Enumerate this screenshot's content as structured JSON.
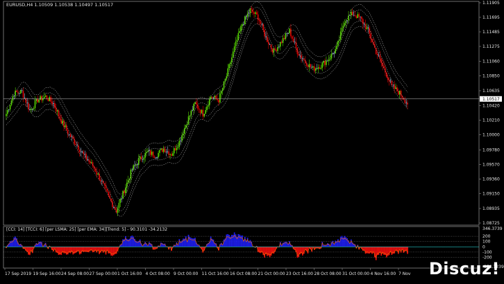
{
  "chart_header": "EURUSD,H4  1.10509 1.10538 1.10497 1.10517",
  "indicator_header": "[CCI: 14] [TCCI: 6] [per LSMA: 25] [per EMA: 34][Trend: 5] -  90.3101 -34.2132",
  "price_axis": [
    "1.11905",
    "1.11695",
    "1.11485",
    "1.11275",
    "1.11060",
    "1.10850",
    "1.10635",
    "1.10420",
    "1.10210",
    "1.10000",
    "1.09780",
    "1.09570",
    "1.09360",
    "1.09150",
    "1.08935",
    "1.08725"
  ],
  "current_price": "1.10517",
  "indicator_axis": [
    "346.3739",
    "200",
    "100",
    "0",
    "-100",
    "-200",
    "-378.1239"
  ],
  "time_axis": [
    "17 Sep 2019",
    "19 Sep 16:00",
    "24 Sep 08:00",
    "27 Sep 00:00",
    "1 Oct 16:00",
    "4 Oct 08:00",
    "9 Oct 00:00",
    "11 Oct 16:00",
    "16 Oct 08:00",
    "21 Oct 00:00",
    "23 Oct 16:00",
    "28 Oct 08:00",
    "31 Oct 00:00",
    "4 Nov 16:00",
    "7 Nov"
  ],
  "watermark": "Discuz!",
  "colors": {
    "bull": "#55d400",
    "bear": "#e00000",
    "neutral": "#9db8d8",
    "band": "#d0d0d0",
    "cci_pos": "#2020ff",
    "cci_neg": "#ff1010"
  },
  "chart_data": {
    "type": "candlestick",
    "symbol": "EURUSD",
    "timeframe": "H4",
    "ylim": [
      1.08725,
      1.11905
    ],
    "last": 1.10517,
    "path": [
      [
        0,
        1.103
      ],
      [
        6,
        1.106
      ],
      [
        12,
        1.1062
      ],
      [
        18,
        1.1035
      ],
      [
        24,
        1.105
      ],
      [
        30,
        1.1055
      ],
      [
        36,
        1.1045
      ],
      [
        42,
        1.102
      ],
      [
        48,
        1.1
      ],
      [
        54,
        1.0985
      ],
      [
        60,
        1.0968
      ],
      [
        66,
        1.0955
      ],
      [
        72,
        1.0935
      ],
      [
        78,
        1.091
      ],
      [
        84,
        1.089
      ],
      [
        90,
        1.092
      ],
      [
        96,
        1.095
      ],
      [
        102,
        1.0965
      ],
      [
        108,
        1.0975
      ],
      [
        114,
        1.097
      ],
      [
        120,
        1.098
      ],
      [
        126,
        1.0972
      ],
      [
        132,
        1.099
      ],
      [
        138,
        1.102
      ],
      [
        144,
        1.1045
      ],
      [
        150,
        1.103
      ],
      [
        156,
        1.1055
      ],
      [
        162,
        1.105
      ],
      [
        168,
        1.1085
      ],
      [
        174,
        1.1125
      ],
      [
        180,
        1.116
      ],
      [
        186,
        1.118
      ],
      [
        192,
        1.117
      ],
      [
        198,
        1.114
      ],
      [
        204,
        1.112
      ],
      [
        210,
        1.1135
      ],
      [
        216,
        1.115
      ],
      [
        222,
        1.112
      ],
      [
        228,
        1.1105
      ],
      [
        234,
        1.1095
      ],
      [
        240,
        1.11
      ],
      [
        246,
        1.111
      ],
      [
        252,
        1.1125
      ],
      [
        258,
        1.1165
      ],
      [
        264,
        1.1175
      ],
      [
        270,
        1.1168
      ],
      [
        276,
        1.115
      ],
      [
        282,
        1.112
      ],
      [
        288,
        1.1095
      ],
      [
        294,
        1.107
      ],
      [
        300,
        1.106
      ],
      [
        306,
        1.1045
      ]
    ]
  }
}
